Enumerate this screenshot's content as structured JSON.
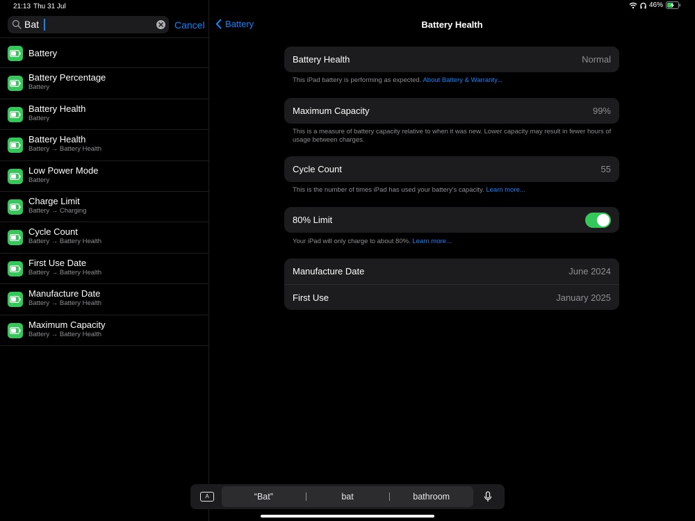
{
  "status_bar": {
    "time": "21:13",
    "date": "Thu 31 Jul",
    "battery_percent": "46%"
  },
  "search": {
    "query": "Bat",
    "cancel_label": "Cancel"
  },
  "results": [
    {
      "title": "Battery",
      "subtitle": ""
    },
    {
      "title": "Battery Percentage",
      "subtitle": "Battery"
    },
    {
      "title": "Battery Health",
      "subtitle": "Battery"
    },
    {
      "title": "Battery Health",
      "subtitle": "Battery → Battery Health"
    },
    {
      "title": "Low Power Mode",
      "subtitle": "Battery"
    },
    {
      "title": "Charge Limit",
      "subtitle": "Battery → Charging"
    },
    {
      "title": "Cycle Count",
      "subtitle": "Battery → Battery Health"
    },
    {
      "title": "First Use Date",
      "subtitle": "Battery → Battery Health"
    },
    {
      "title": "Manufacture Date",
      "subtitle": "Battery → Battery Health"
    },
    {
      "title": "Maximum Capacity",
      "subtitle": "Battery → Battery Health"
    }
  ],
  "nav": {
    "back_label": "Battery",
    "title": "Battery Health"
  },
  "health": {
    "label": "Battery Health",
    "value": "Normal",
    "note": "This iPad battery is performing as expected.",
    "link": "About Battery & Warranty..."
  },
  "capacity": {
    "label": "Maximum Capacity",
    "value": "99%",
    "note": "This is a measure of battery capacity relative to when it was new. Lower capacity may result in fewer hours of usage between charges."
  },
  "cycle": {
    "label": "Cycle Count",
    "value": "55",
    "note": "This is the number of times iPad has used your battery's capacity.",
    "link": "Learn more..."
  },
  "limit": {
    "label": "80% Limit",
    "enabled": true,
    "note": "Your iPad will only charge to about 80%.",
    "link": "Learn more..."
  },
  "dates": {
    "manufacture_label": "Manufacture Date",
    "manufacture_value": "June 2024",
    "first_use_label": "First Use",
    "first_use_value": "January 2025"
  },
  "keyboard": {
    "suggestions": [
      "“Bat”",
      "bat",
      "bathroom"
    ]
  },
  "colors": {
    "accent": "#0a84ff",
    "green": "#34c759",
    "cell": "#1c1c1e"
  }
}
